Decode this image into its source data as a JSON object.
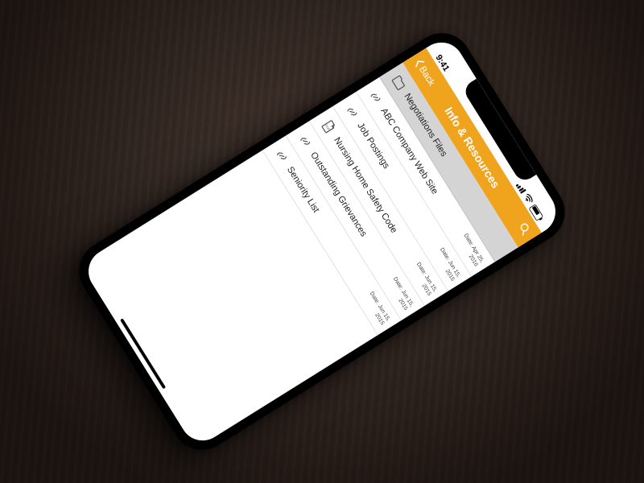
{
  "status_time": "9:41",
  "nav": {
    "back": "Back",
    "title": "Info & Resources"
  },
  "rows": [
    {
      "icon": "folder",
      "label": "Negotiations Files",
      "date": "",
      "selected": true
    },
    {
      "icon": "link",
      "label": "ABC Company Web Site",
      "date": "Date: Apr 25,\n2016"
    },
    {
      "icon": "link",
      "label": "Job Postings",
      "date": "Date: Jun 15,\n2015"
    },
    {
      "icon": "doc",
      "label": "Nursing Home Safety Code",
      "date": "Date: Jun 15,\n2015"
    },
    {
      "icon": "link",
      "label": "Outstanding Grievances",
      "date": "Date: Jun 15,\n2015"
    },
    {
      "icon": "link",
      "label": "Seniority List",
      "date": "Date: Jun 15,\n2015"
    }
  ]
}
